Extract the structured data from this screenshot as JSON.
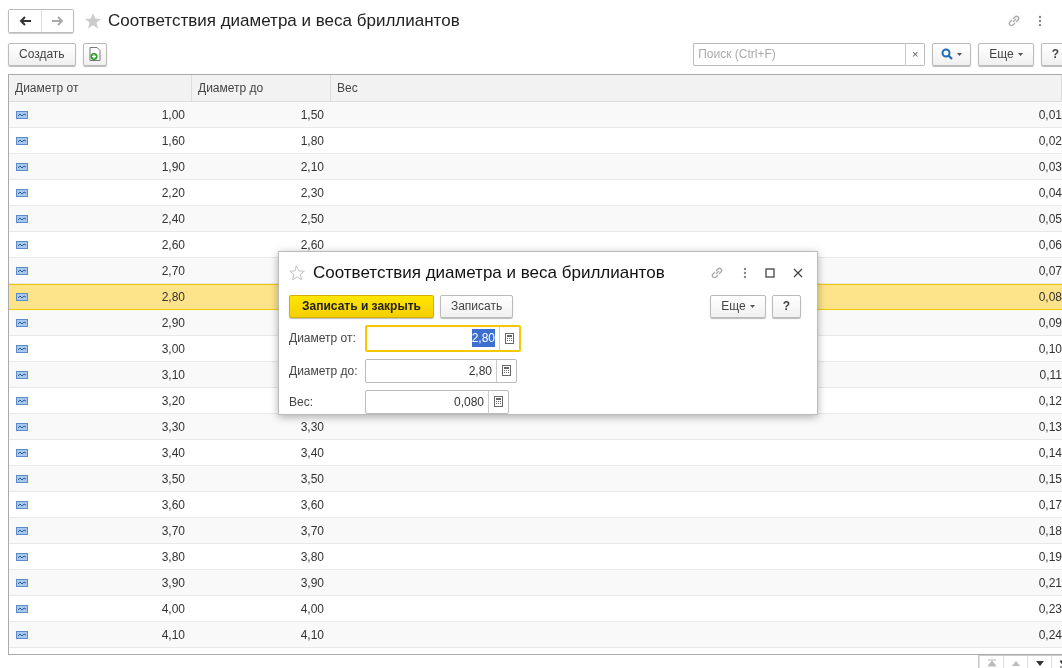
{
  "window": {
    "title": "Соответствия диаметра и веса бриллиантов"
  },
  "toolbar": {
    "create": "Создать",
    "search_placeholder": "Поиск (Ctrl+F)",
    "clear": "×",
    "more": "Еще",
    "help": "?"
  },
  "table": {
    "columns": [
      "Диаметр от",
      "Диаметр до",
      "Вес"
    ],
    "rows": [
      {
        "from": "1,00",
        "to": "1,50",
        "weight": "0,01",
        "selected": false
      },
      {
        "from": "1,60",
        "to": "1,80",
        "weight": "0,02",
        "selected": false
      },
      {
        "from": "1,90",
        "to": "2,10",
        "weight": "0,03",
        "selected": false
      },
      {
        "from": "2,20",
        "to": "2,30",
        "weight": "0,04",
        "selected": false
      },
      {
        "from": "2,40",
        "to": "2,50",
        "weight": "0,05",
        "selected": false
      },
      {
        "from": "2,60",
        "to": "2,60",
        "weight": "0,06",
        "selected": false
      },
      {
        "from": "2,70",
        "weight": "0,07",
        "selected": false
      },
      {
        "from": "2,80",
        "weight": "0,08",
        "selected": true
      },
      {
        "from": "2,90",
        "weight": "0,09",
        "selected": false
      },
      {
        "from": "3,00",
        "weight": "0,10",
        "selected": false
      },
      {
        "from": "3,10",
        "weight": "0,11",
        "selected": false
      },
      {
        "from": "3,20",
        "weight": "0,12",
        "selected": false
      },
      {
        "from": "3,30",
        "to": "3,30",
        "weight": "0,13",
        "selected": false
      },
      {
        "from": "3,40",
        "to": "3,40",
        "weight": "0,14",
        "selected": false
      },
      {
        "from": "3,50",
        "to": "3,50",
        "weight": "0,15",
        "selected": false
      },
      {
        "from": "3,60",
        "to": "3,60",
        "weight": "0,17",
        "selected": false
      },
      {
        "from": "3,70",
        "to": "3,70",
        "weight": "0,18",
        "selected": false
      },
      {
        "from": "3,80",
        "to": "3,80",
        "weight": "0,19",
        "selected": false
      },
      {
        "from": "3,90",
        "to": "3,90",
        "weight": "0,21",
        "selected": false
      },
      {
        "from": "4,00",
        "to": "4,00",
        "weight": "0,23",
        "selected": false
      },
      {
        "from": "4,10",
        "to": "4,10",
        "weight": "0,24",
        "selected": false
      }
    ]
  },
  "dialog": {
    "title": "Соответствия диаметра и веса бриллиантов",
    "save_close": "Записать и закрыть",
    "save": "Записать",
    "more": "Еще",
    "help": "?",
    "fields": [
      {
        "label": "Диаметр от:",
        "value": "2,80",
        "focused": true
      },
      {
        "label": "Диаметр до:",
        "value": "2,80",
        "focused": false
      },
      {
        "label": "Вес:",
        "value": "0,080",
        "focused": false
      }
    ]
  }
}
